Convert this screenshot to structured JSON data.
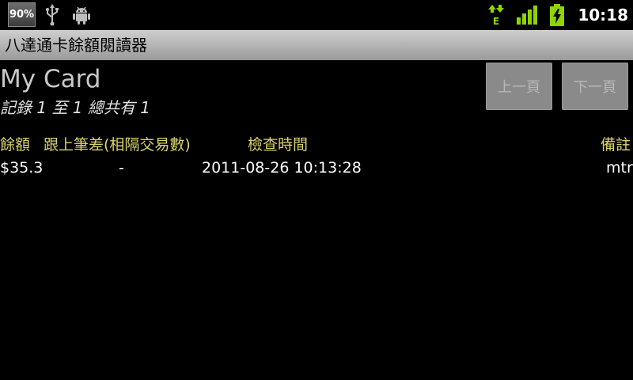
{
  "status_bar": {
    "battery_percent": "90%",
    "time": "10:18",
    "network_type": "E",
    "icons": [
      "usb-icon",
      "android-icon",
      "data-activity-icon",
      "signal-icon",
      "battery-charging-icon"
    ]
  },
  "app": {
    "title": "八達通卡餘額閱讀器",
    "card_name": "My Card",
    "record_summary": "記錄 1 至 1 總共有 1",
    "buttons": {
      "prev": "上一頁",
      "next": "下一頁"
    }
  },
  "table": {
    "headers": [
      "餘額",
      "跟上筆差(相隔交易數)",
      "檢查時間",
      "備註"
    ],
    "rows": [
      [
        "$35.3",
        "-",
        "2011-08-26 10:13:28",
        "mtr"
      ]
    ]
  },
  "colors": {
    "header_text": "#d9d36b",
    "status_green": "#8fd400",
    "background": "#000000"
  }
}
